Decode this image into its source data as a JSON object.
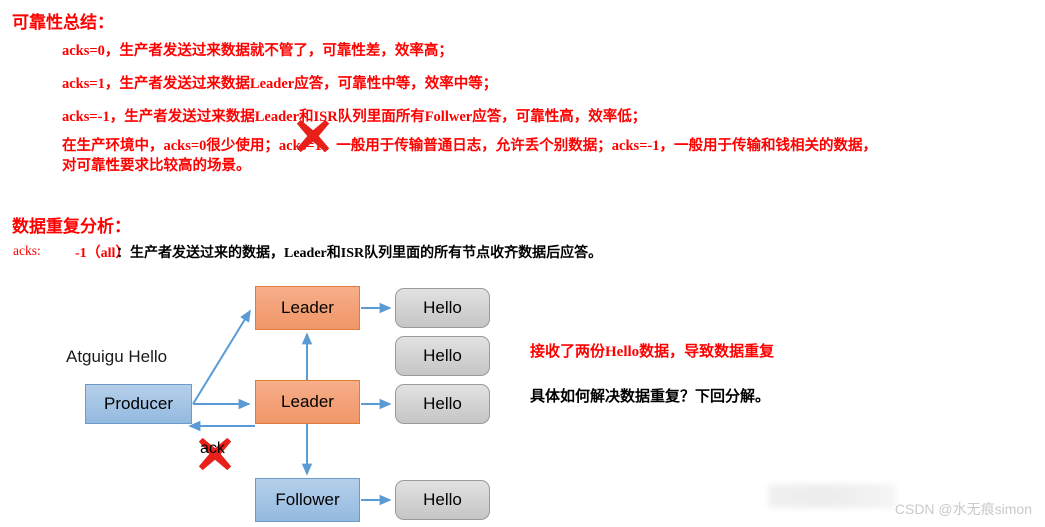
{
  "reliability": {
    "heading": "可靠性总结：",
    "lines": [
      "acks=0，生产者发送过来数据就不管了，可靠性差，效率高；",
      "acks=1，生产者发送过来数据Leader应答，可靠性中等，效率中等；",
      "acks=-1，生产者发送过来数据Leader和ISR队列里面所有Follwer应答，可靠性高，效率低；"
    ],
    "production_note_line1": "在生产环境中，acks=0很少使用；acks=1，一般用于传输普通日志，允许丢个别数据；acks=-1，一般用于传输和钱相关的数据，",
    "production_note_line2": "对可靠性要求比较高的场景。"
  },
  "duplication": {
    "heading": "数据重复分析：",
    "acks_label": "acks:",
    "acks_value": "-1（all）",
    "acks_description": "：生产者发送过来的数据，Leader和ISR队列里面的所有节点收齐数据后应答。"
  },
  "diagram": {
    "producer_input_label": "Atguigu Hello",
    "ack_label": "ack",
    "nodes": {
      "producer": "Producer",
      "leader_top": "Leader",
      "leader_middle": "Leader",
      "follower": "Follower",
      "hello_1": "Hello",
      "hello_2": "Hello",
      "hello_3": "Hello",
      "hello_4": "Hello"
    },
    "colors": {
      "leader_fill": "#F4A27A",
      "leader_border": "#E07B3A",
      "producer_fill": "#A6C6E6",
      "producer_border": "#6A9BCB",
      "hello_fill": "#D3D3D3",
      "hello_border": "#9A9A9A",
      "arrow": "#5B9BD5",
      "x_mark": "#E8201A",
      "red_text": "#FF0000"
    }
  },
  "annotations": {
    "duplicate_warning": "接收了两份Hello数据，导致数据重复",
    "next_episode": "具体如何解决数据重复？下回分解。"
  },
  "watermark": {
    "text": "CSDN @水无痕simon"
  }
}
